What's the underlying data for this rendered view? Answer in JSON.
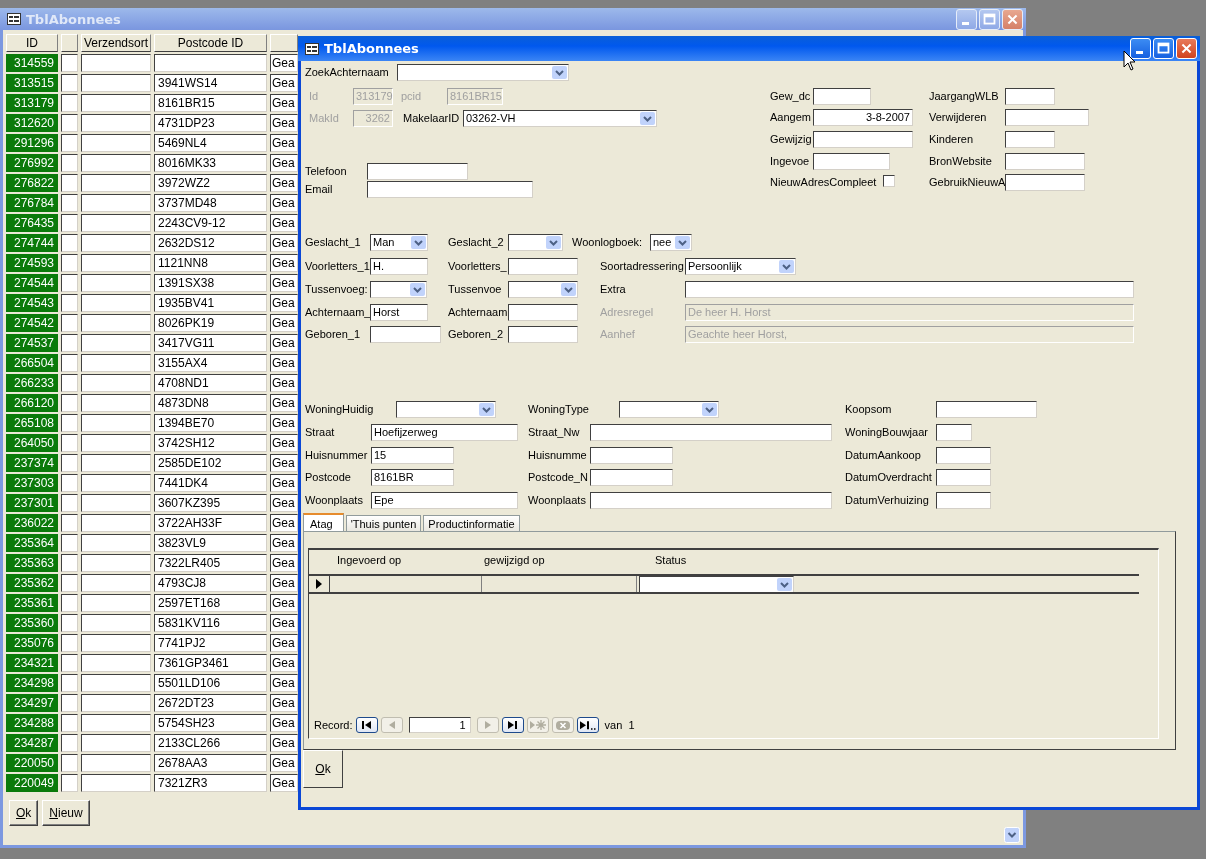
{
  "back_window": {
    "title": "TblAbonnees",
    "columns": [
      {
        "label": "ID"
      },
      {
        "label": "Verzendsort"
      },
      {
        "label": "Postcode ID"
      }
    ],
    "rows": [
      {
        "id": "314559",
        "column_5": "Gea"
      },
      {
        "id": "313515",
        "postcode_id": "3941WS14",
        "column_5": "Gea"
      },
      {
        "id": "313179",
        "postcode_id": "8161BR15",
        "column_5": "Gea"
      },
      {
        "id": "312620",
        "postcode_id": "4731DP23",
        "column_5": "Gea"
      },
      {
        "id": "291296",
        "postcode_id": "5469NL4",
        "column_5": "Gea"
      },
      {
        "id": "276992",
        "postcode_id": "8016MK33",
        "column_5": "Gea"
      },
      {
        "id": "276822",
        "postcode_id": "3972WZ2",
        "column_5": "Gea"
      },
      {
        "id": "276784",
        "postcode_id": "3737MD48",
        "column_5": "Gea"
      },
      {
        "id": "276435",
        "postcode_id": "2243CV9-12",
        "column_5": "Gea"
      },
      {
        "id": "274744",
        "postcode_id": "2632DS12",
        "column_5": "Gea"
      },
      {
        "id": "274593",
        "postcode_id": "1121NN8",
        "column_5": "Gea"
      },
      {
        "id": "274544",
        "postcode_id": "1391SX38",
        "column_5": "Gea"
      },
      {
        "id": "274543",
        "postcode_id": "1935BV41",
        "column_5": "Gea"
      },
      {
        "id": "274542",
        "postcode_id": "8026PK19",
        "column_5": "Gea"
      },
      {
        "id": "274537",
        "postcode_id": "3417VG11",
        "column_5": "Gea"
      },
      {
        "id": "266504",
        "postcode_id": "3155AX4",
        "column_5": "Gea"
      },
      {
        "id": "266233",
        "postcode_id": "4708ND1",
        "column_5": "Gea"
      },
      {
        "id": "266120",
        "postcode_id": "4873DN8",
        "column_5": "Gea"
      },
      {
        "id": "265108",
        "postcode_id": "1394BE70",
        "column_5": "Gea"
      },
      {
        "id": "264050",
        "postcode_id": "3742SH12",
        "column_5": "Gea"
      },
      {
        "id": "237374",
        "postcode_id": "2585DE102",
        "column_5": "Gea"
      },
      {
        "id": "237303",
        "postcode_id": "7441DK4",
        "column_5": "Gea"
      },
      {
        "id": "237301",
        "postcode_id": "3607KZ395",
        "column_5": "Gea"
      },
      {
        "id": "236022",
        "postcode_id": "3722AH33F",
        "column_5": "Gea"
      },
      {
        "id": "235364",
        "postcode_id": "3823VL9",
        "column_5": "Gea"
      },
      {
        "id": "235363",
        "postcode_id": "7322LR405",
        "column_5": "Gea"
      },
      {
        "id": "235362",
        "postcode_id": "4793CJ8",
        "column_5": "Gea"
      },
      {
        "id": "235361",
        "postcode_id": "2597ET168",
        "column_5": "Gea"
      },
      {
        "id": "235360",
        "postcode_id": "5831KV116",
        "column_5": "Gea"
      },
      {
        "id": "235076",
        "postcode_id": "7741PJ2",
        "column_5": "Gea"
      },
      {
        "id": "234321",
        "postcode_id": "7361GP3461",
        "column_5": "Gea"
      },
      {
        "id": "234298",
        "postcode_id": "5501LD106",
        "column_5": "Gea"
      },
      {
        "id": "234297",
        "postcode_id": "2672DT23",
        "column_5": "Gea"
      },
      {
        "id": "234288",
        "postcode_id": "5754SH23",
        "column_5": "Gea"
      },
      {
        "id": "234287",
        "postcode_id": "2133CL266",
        "column_5": "Gea"
      },
      {
        "id": "220050",
        "postcode_id": "2678AA3",
        "column_5": "Gea"
      },
      {
        "id": "220049",
        "postcode_id": "7321ZR3",
        "column_5": "Gea"
      }
    ],
    "buttons": [
      "Ok",
      "Nieuw"
    ]
  },
  "form_window": {
    "title": "TblAbonnees",
    "fields": [
      {
        "label": "ZoekAchternaam",
        "kind": "combo",
        "disabled": false
      },
      {
        "label": "Id",
        "kind": "text",
        "value": "313179",
        "disabled": true
      },
      {
        "label": "pcid",
        "kind": "text",
        "value": "8161BR15",
        "disabled": true
      },
      {
        "label": "MakId",
        "kind": "text",
        "value": "3262",
        "disabled": true
      },
      {
        "label": "MakelaarID",
        "kind": "combo",
        "value": "03262-VH",
        "disabled": false
      },
      {
        "label": "Telefoon",
        "kind": "text",
        "disabled": false
      },
      {
        "label": "Email",
        "kind": "text",
        "disabled": false
      },
      {
        "label": "Gew_dc",
        "kind": "text",
        "disabled": false
      },
      {
        "label": "Aangem",
        "kind": "text",
        "value": "3-8-2007",
        "disabled": false
      },
      {
        "label": "Gewijzig",
        "kind": "text",
        "disabled": false
      },
      {
        "label": "Ingevoe",
        "kind": "text",
        "disabled": false
      },
      {
        "label": "NieuwAdresCompleet",
        "kind": "check",
        "checked": false,
        "disabled": false
      },
      {
        "label": "JaargangWLB",
        "kind": "text",
        "disabled": false
      },
      {
        "label": "Verwijderen",
        "kind": "text",
        "disabled": false
      },
      {
        "label": "Kinderen",
        "kind": "text",
        "disabled": false
      },
      {
        "label": "BronWebsite",
        "kind": "text",
        "disabled": false
      },
      {
        "label": "GebruikNieuwA",
        "kind": "text",
        "disabled": false
      },
      {
        "label": "Geslacht_1",
        "kind": "combo",
        "value": "Man",
        "disabled": false
      },
      {
        "label": "Geslacht_2",
        "kind": "combo",
        "disabled": false
      },
      {
        "label": "Woonlogboek:",
        "kind": "combo",
        "value": "nee",
        "disabled": false
      },
      {
        "label": "Voorletters_1",
        "kind": "text",
        "value": "H.",
        "disabled": false
      },
      {
        "label": "Voorletters_",
        "kind": "text",
        "disabled": false
      },
      {
        "label": "Soortadressering",
        "kind": "combo",
        "value": "Persoonlijk",
        "disabled": false
      },
      {
        "label": "Tussenvoeg:",
        "kind": "combo",
        "disabled": false
      },
      {
        "label": "Tussenvoe",
        "kind": "combo",
        "disabled": false
      },
      {
        "label": "Extra",
        "kind": "text",
        "disabled": false
      },
      {
        "label": "Achternaam_",
        "kind": "text",
        "value": "Horst",
        "disabled": false
      },
      {
        "label": "Achternaam",
        "kind": "text",
        "disabled": false
      },
      {
        "label": "Adresregel",
        "kind": "text",
        "value": "De heer H. Horst",
        "disabled": true
      },
      {
        "label": "Geboren_1",
        "kind": "text",
        "disabled": false
      },
      {
        "label": "Geboren_2",
        "kind": "text",
        "disabled": false
      },
      {
        "label": "Aanhef",
        "kind": "text",
        "value": "Geachte heer Horst,",
        "disabled": true
      },
      {
        "label": "WoningHuidig",
        "kind": "combo",
        "disabled": false
      },
      {
        "label": "WoningType",
        "kind": "combo",
        "disabled": false
      },
      {
        "label": "Koopsom",
        "kind": "text",
        "disabled": false
      },
      {
        "label": "Straat",
        "kind": "text",
        "value": "Hoefijzerweg",
        "disabled": false
      },
      {
        "label": "Straat_Nw",
        "kind": "text",
        "disabled": false
      },
      {
        "label": "WoningBouwjaar",
        "kind": "text",
        "disabled": false
      },
      {
        "label": "Huisnummer",
        "kind": "text",
        "value": "15",
        "disabled": false
      },
      {
        "label": "Huisnumme",
        "kind": "text",
        "disabled": false
      },
      {
        "label": "DatumAankoop",
        "kind": "text",
        "disabled": false
      },
      {
        "label": "Postcode",
        "kind": "text",
        "value": "8161BR",
        "disabled": false
      },
      {
        "label": "Postcode_N",
        "kind": "text",
        "disabled": false
      },
      {
        "label": "DatumOverdracht",
        "kind": "text",
        "disabled": false
      },
      {
        "label": "Woonplaats",
        "kind": "text",
        "value": "Epe",
        "disabled": false
      },
      {
        "label": "Woonplaats",
        "kind": "text",
        "disabled": false
      },
      {
        "label": "DatumVerhuizing",
        "kind": "text",
        "disabled": false
      }
    ],
    "tabs": [
      {
        "label": "Atag",
        "selected": true
      },
      {
        "label": "'Thuis punten",
        "selected": false
      },
      {
        "label": "Productinformatie",
        "selected": false
      }
    ],
    "subform": {
      "columns": [
        "Ingevoerd op",
        "gewijzigd op",
        "Status"
      ],
      "navigation": {
        "label": "Record:",
        "current": "1",
        "of_label": "van",
        "total": "1",
        "buttons": [
          {
            "kind": "first",
            "disabled": false
          },
          {
            "kind": "prev",
            "disabled": true
          },
          {
            "kind": "next",
            "disabled": true
          },
          {
            "kind": "last",
            "disabled": false
          },
          {
            "kind": "new",
            "disabled": true
          },
          {
            "kind": "delete",
            "disabled": true
          },
          {
            "kind": "last_new",
            "disabled": false
          }
        ]
      }
    },
    "buttons": [
      "Ok"
    ]
  }
}
